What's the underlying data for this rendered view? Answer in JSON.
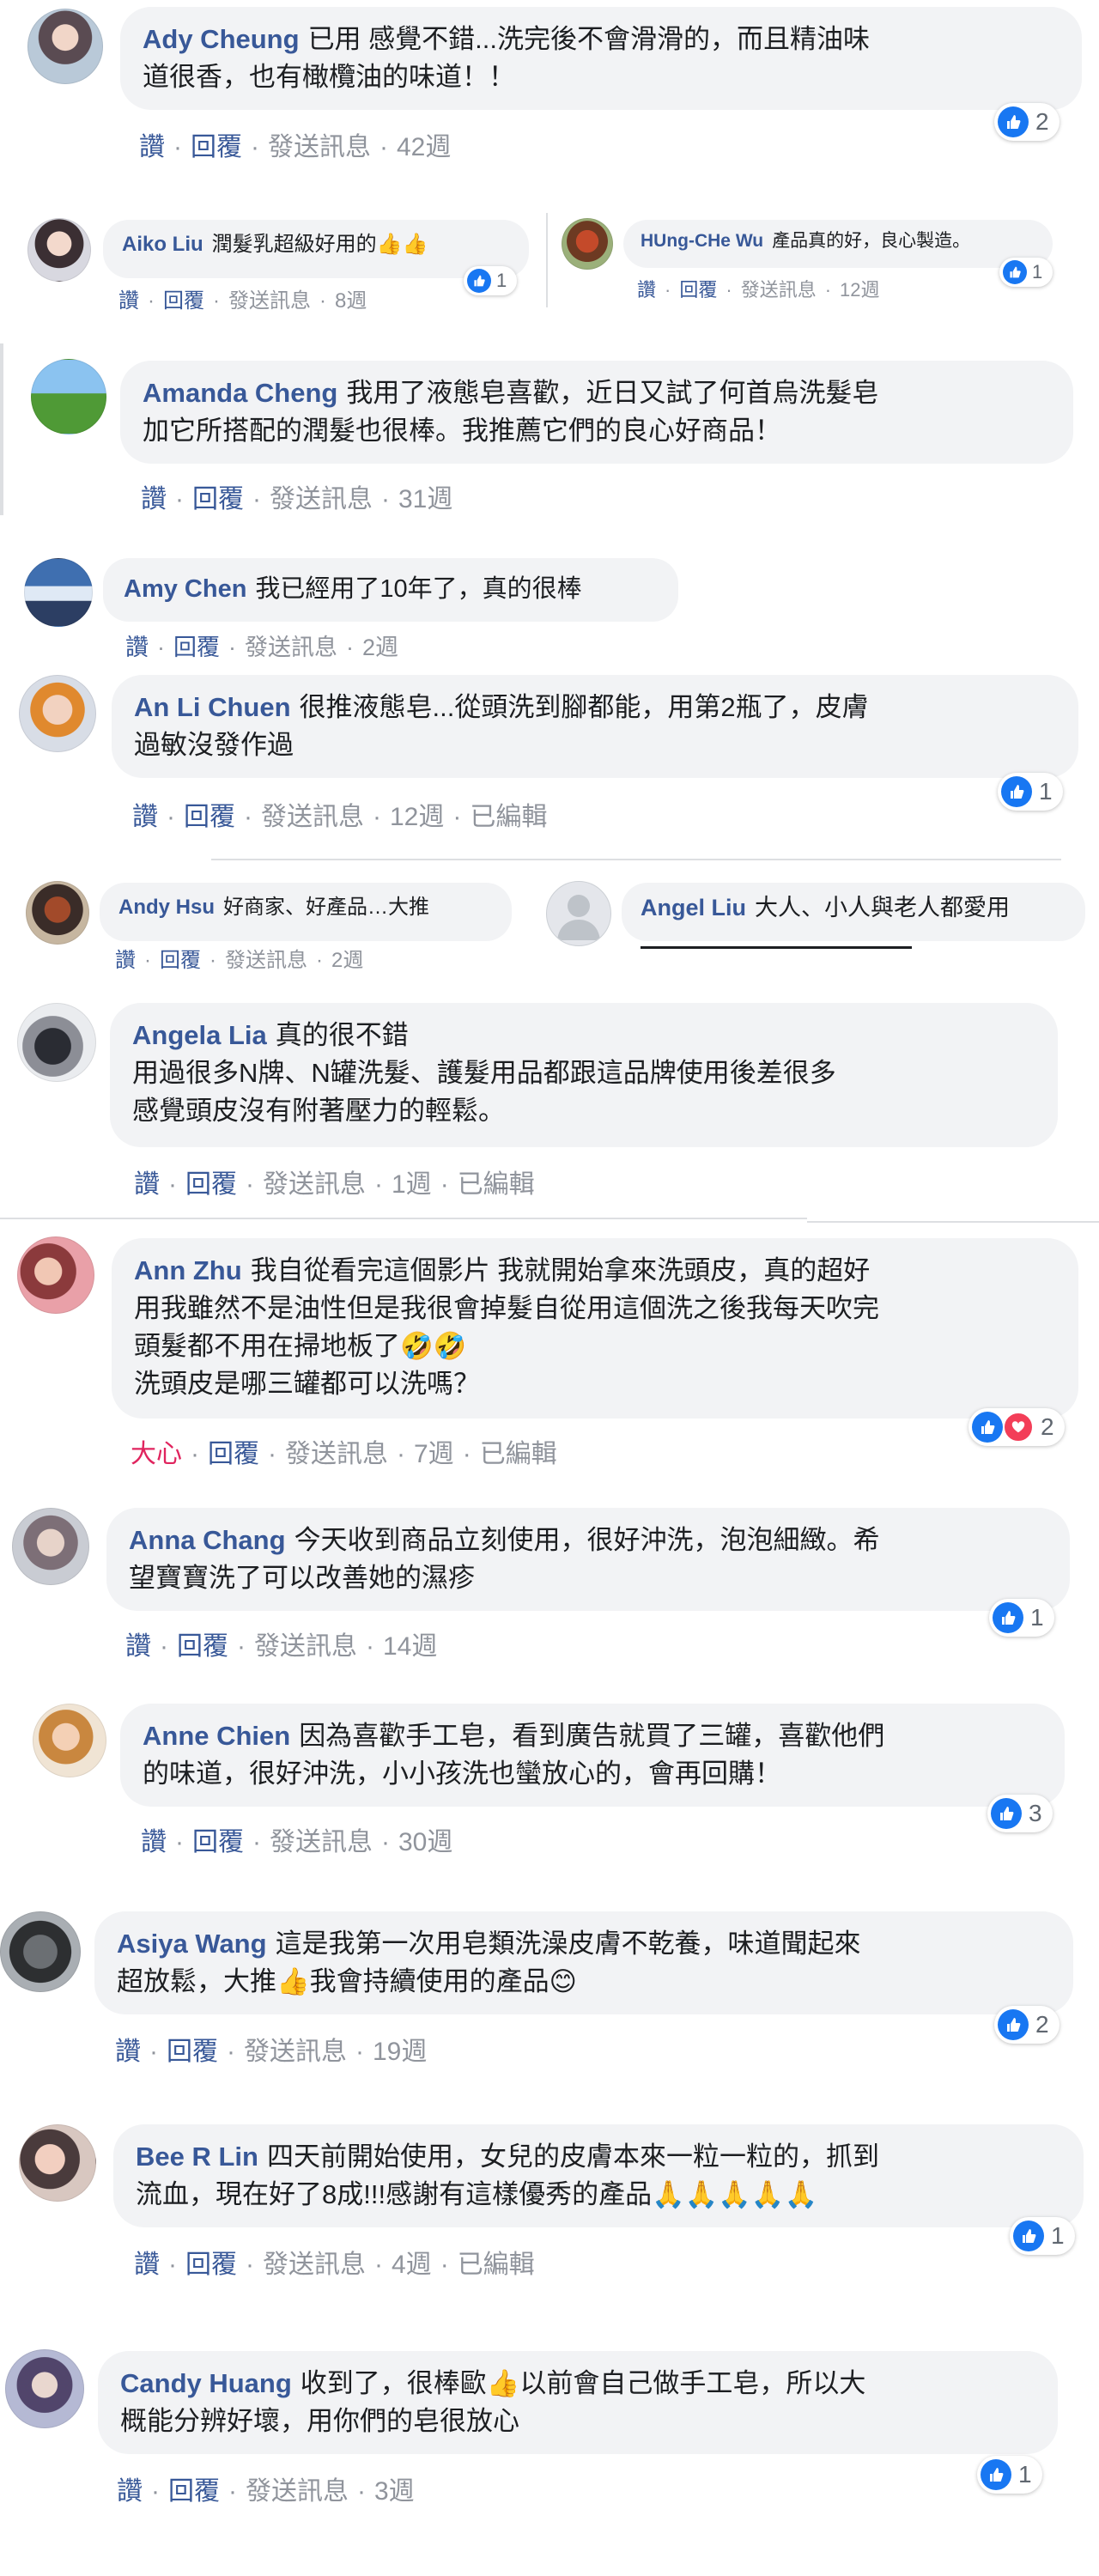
{
  "actions": {
    "like": "讚",
    "reply": "回覆",
    "message": "發送訊息",
    "love": "大心",
    "edited": "已編輯"
  },
  "comments": [
    {
      "name": "Ady Cheung",
      "lines": [
        "已用 感覺不錯...洗完後不會滑滑的，而且精油味",
        "道很香，也有橄欖油的味道！！"
      ],
      "time": "42週",
      "reactions": "2"
    },
    {
      "name": "Aiko Liu",
      "lines": [
        "潤髮乳超級好用的👍👍"
      ],
      "time": "8週",
      "reactions": "1"
    },
    {
      "name": "HUng-CHe Wu",
      "lines": [
        "產品真的好，良心製造。"
      ],
      "time": "12週",
      "reactions": "1"
    },
    {
      "name": "Amanda Cheng",
      "lines": [
        "我用了液態皂喜歡，近日又試了何首烏洗髮皂",
        "加它所搭配的潤髮也很棒。我推薦它們的良心好商品！"
      ],
      "time": "31週"
    },
    {
      "name": "Amy Chen",
      "lines": [
        "我已經用了10年了，真的很棒"
      ],
      "time": "2週"
    },
    {
      "name": "An Li Chuen",
      "lines": [
        "很推液態皂...從頭洗到腳都能，用第2瓶了，皮膚",
        "過敏沒發作過"
      ],
      "time": "12週",
      "reactions": "1"
    },
    {
      "name": "Andy Hsu",
      "lines": [
        "好商家、好產品…大推"
      ],
      "time": "2週"
    },
    {
      "name": "Angel Liu",
      "lines": [
        "大人、小人與老人都愛用"
      ]
    },
    {
      "name": "Angela Lia",
      "lines": [
        "真的很不錯",
        "用過很多N牌、N罐洗髮、護髮用品都跟這品牌使用後差很多",
        "感覺頭皮沒有附著壓力的輕鬆。"
      ],
      "time": "1週"
    },
    {
      "name": "Ann Zhu",
      "lines": [
        "我自從看完這個影片 我就開始拿來洗頭皮，真的超好",
        "用我雖然不是油性但是我很會掉髮自從用這個洗之後我每天吹完",
        "頭髮都不用在掃地板了🤣🤣",
        "洗頭皮是哪三罐都可以洗嗎？"
      ],
      "time": "7週",
      "reactions": "2"
    },
    {
      "name": "Anna Chang",
      "lines": [
        "今天收到商品立刻使用，很好沖洗，泡泡細緻。希",
        "望寶寶洗了可以改善她的濕疹"
      ],
      "time": "14週",
      "reactions": "1"
    },
    {
      "name": "Anne Chien",
      "lines": [
        "因為喜歡手工皂，看到廣告就買了三罐，喜歡他們",
        "的味道，很好沖洗，小小孩洗也蠻放心的，會再回購！"
      ],
      "time": "30週",
      "reactions": "3"
    },
    {
      "name": "Asiya Wang",
      "lines": [
        "這是我第一次用皂類洗澡皮膚不乾養，味道聞起來",
        "超放鬆，大推👍我會持續使用的產品😊"
      ],
      "time": "19週",
      "reactions": "2"
    },
    {
      "name": "Bee R Lin",
      "lines": [
        "四天前開始使用，女兒的皮膚本來一粒一粒的，抓到",
        "流血，現在好了8成!!!感謝有這樣優秀的產品🙏🙏🙏🙏🙏"
      ],
      "time": "4週",
      "reactions": "1"
    },
    {
      "name": "Candy Huang",
      "lines": [
        "收到了，很棒歐👍以前會自己做手工皂，所以大",
        "概能分辨好壞，用你們的皂很放心"
      ],
      "time": "3週",
      "reactions": "1"
    }
  ]
}
